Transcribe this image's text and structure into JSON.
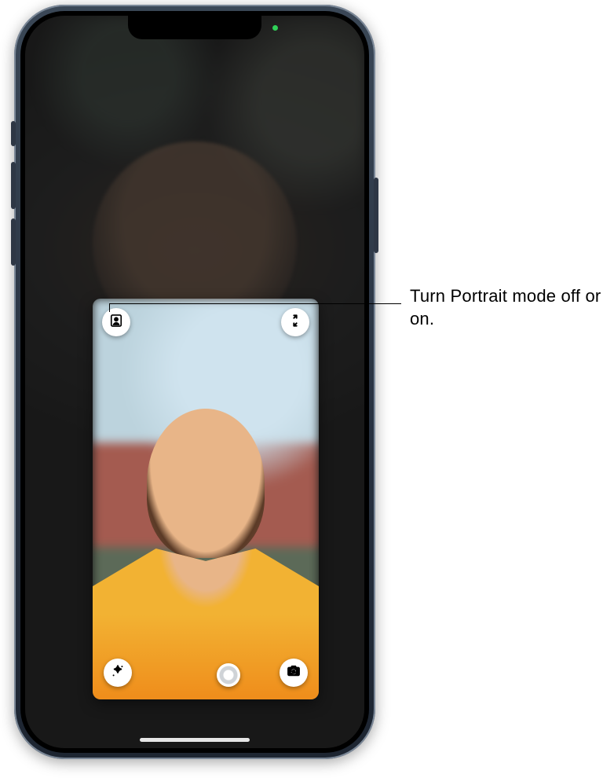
{
  "callout": {
    "text": "Turn Portrait mode off or on."
  },
  "status": {
    "camera_active_color": "#30d158"
  },
  "pip": {
    "buttons": {
      "portrait_mode": {
        "icon": "portrait-person-icon"
      },
      "collapse": {
        "icon": "collapse-arrows-icon"
      },
      "effects": {
        "icon": "effects-star-icon"
      },
      "take_photo": {
        "icon": "shutter-icon"
      },
      "flip_camera": {
        "icon": "flip-camera-icon"
      }
    }
  }
}
